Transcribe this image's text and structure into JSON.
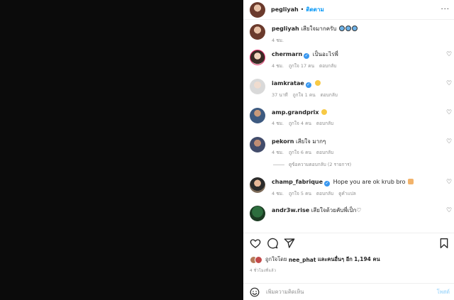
{
  "post": {
    "username": "pegliyah",
    "follow_label": "ติดตาม",
    "separator": "•",
    "caption": {
      "username": "pegliyah",
      "text": "เสียใจมากครับ",
      "time": "4 ชม."
    }
  },
  "comments": [
    {
      "username": "chermarn",
      "verified": true,
      "text": "เป็นอะไรพี่",
      "emoji": "",
      "time": "4 ชม.",
      "likes": "ถูกใจ 17 คน",
      "reply": "ตอบกลับ",
      "extra": ""
    },
    {
      "username": "iamkratae",
      "verified": true,
      "text": "",
      "emoji": "face",
      "time": "37 นาที",
      "likes": "ถูกใจ 1 คน",
      "reply": "ตอบกลับ",
      "extra": ""
    },
    {
      "username": "amp.grandprix",
      "verified": false,
      "text": "",
      "emoji": "face",
      "time": "4 ชม.",
      "likes": "ถูกใจ 4 คน",
      "reply": "ตอบกลับ",
      "extra": ""
    },
    {
      "username": "pekorn",
      "verified": false,
      "text": "เสียใจ มากๆ",
      "emoji": "",
      "time": "4 ชม.",
      "likes": "ถูกใจ 6 คน",
      "reply": "ตอบกลับ",
      "extra": ""
    },
    {
      "username": "champ_fabrique",
      "verified": true,
      "text": "Hope you are ok krub bro",
      "emoji": "hand",
      "time": "4 ชม.",
      "likes": "ถูกใจ 5 คน",
      "reply": "ตอบกลับ",
      "extra": "ดูคำแปล"
    },
    {
      "username": "andr3w.rise",
      "verified": false,
      "text": "เสียใจด้วยคับพี่เป็ก♡",
      "emoji": "",
      "time": "",
      "likes": "",
      "reply": "",
      "extra": ""
    }
  ],
  "view_replies": "ดูข้อความตอบกลับ (2 รายการ)",
  "likes_summary": {
    "prefix": "ถูกใจโดย",
    "user": "nee_phat",
    "middle": "และคนอื่นๆ อีก",
    "count": "1,194 คน"
  },
  "time_ago": "4 ชั่วโมงที่แล้ว",
  "add_comment": {
    "placeholder": "เพิ่มความคิดเห็น",
    "post_label": "โพสต์"
  },
  "icons": {
    "verified": "✓",
    "heart": "♡",
    "more": "···"
  },
  "colors": {
    "link_blue": "#0095f6",
    "post_disabled": "#b2dffc",
    "muted": "#8e8e8e"
  }
}
